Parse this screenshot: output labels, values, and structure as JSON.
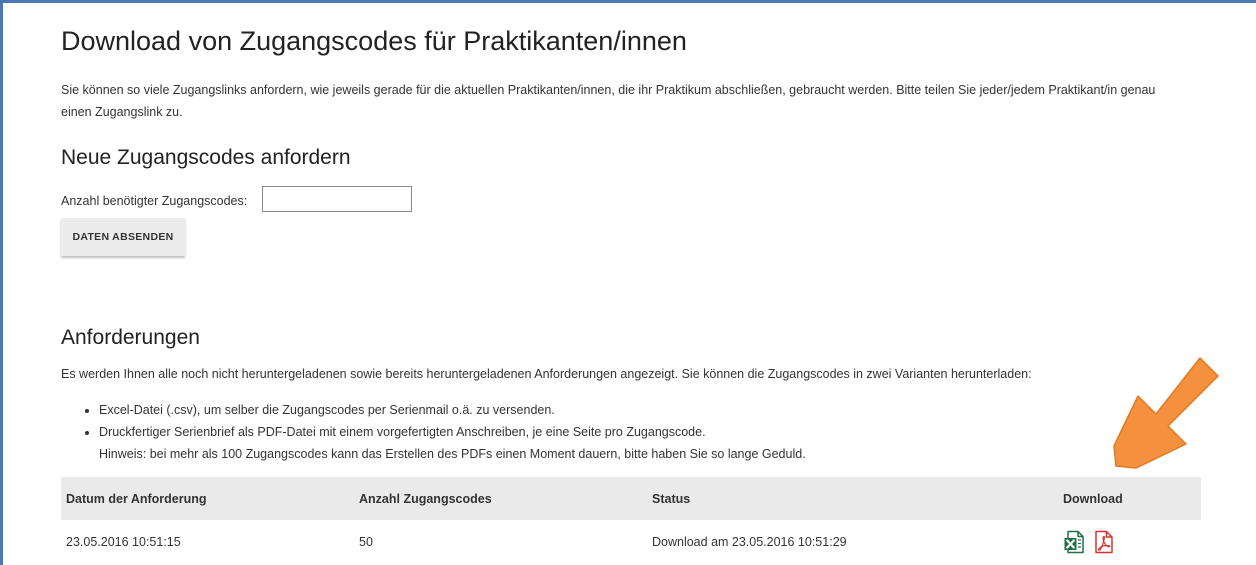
{
  "page": {
    "title": "Download von Zugangscodes für Praktikanten/innen",
    "intro": "Sie können so viele Zugangslinks anfordern, wie jeweils gerade für die aktuellen Praktikanten/innen, die ihr Praktikum abschließen, gebraucht werden. Bitte teilen Sie jeder/jedem Praktikant/in genau einen Zugangslink zu."
  },
  "request_form": {
    "heading": "Neue Zugangscodes anfordern",
    "count_label": "Anzahl benötigter Zugangscodes:",
    "count_value": "",
    "submit_label": "DATEN ABSENDEN"
  },
  "requests": {
    "heading": "Anforderungen",
    "description": "Es werden Ihnen alle noch nicht heruntergeladenen sowie bereits heruntergeladenen Anforderungen angezeigt. Sie können die Zugangscodes in zwei Varianten herunterladen:",
    "bullets": [
      "Excel-Datei (.csv), um selber die Zugangscodes per Serienmail o.ä. zu versenden.",
      "Druckfertiger Serienbrief als PDF-Datei mit einem vorgefertigten Anschreiben, je eine Seite pro Zugangscode."
    ],
    "hint": "Hinweis: bei mehr als 100 Zugangscodes kann das Erstellen des PDFs einen Moment dauern, bitte haben Sie so lange Geduld.",
    "table": {
      "headers": [
        "Datum der Anforderung",
        "Anzahl Zugangscodes",
        "Status",
        "Download"
      ],
      "rows": [
        {
          "date": "23.05.2016 10:51:15",
          "count": "50",
          "status": "Download am 23.05.2016 10:51:29",
          "icons": [
            "excel-icon",
            "pdf-icon"
          ]
        }
      ]
    }
  },
  "colors": {
    "frame": "#4a78b0",
    "arrow": "#f5913e",
    "excel": "#1e7145",
    "pdf": "#d9342b",
    "table_header_bg": "#eaeaea"
  }
}
